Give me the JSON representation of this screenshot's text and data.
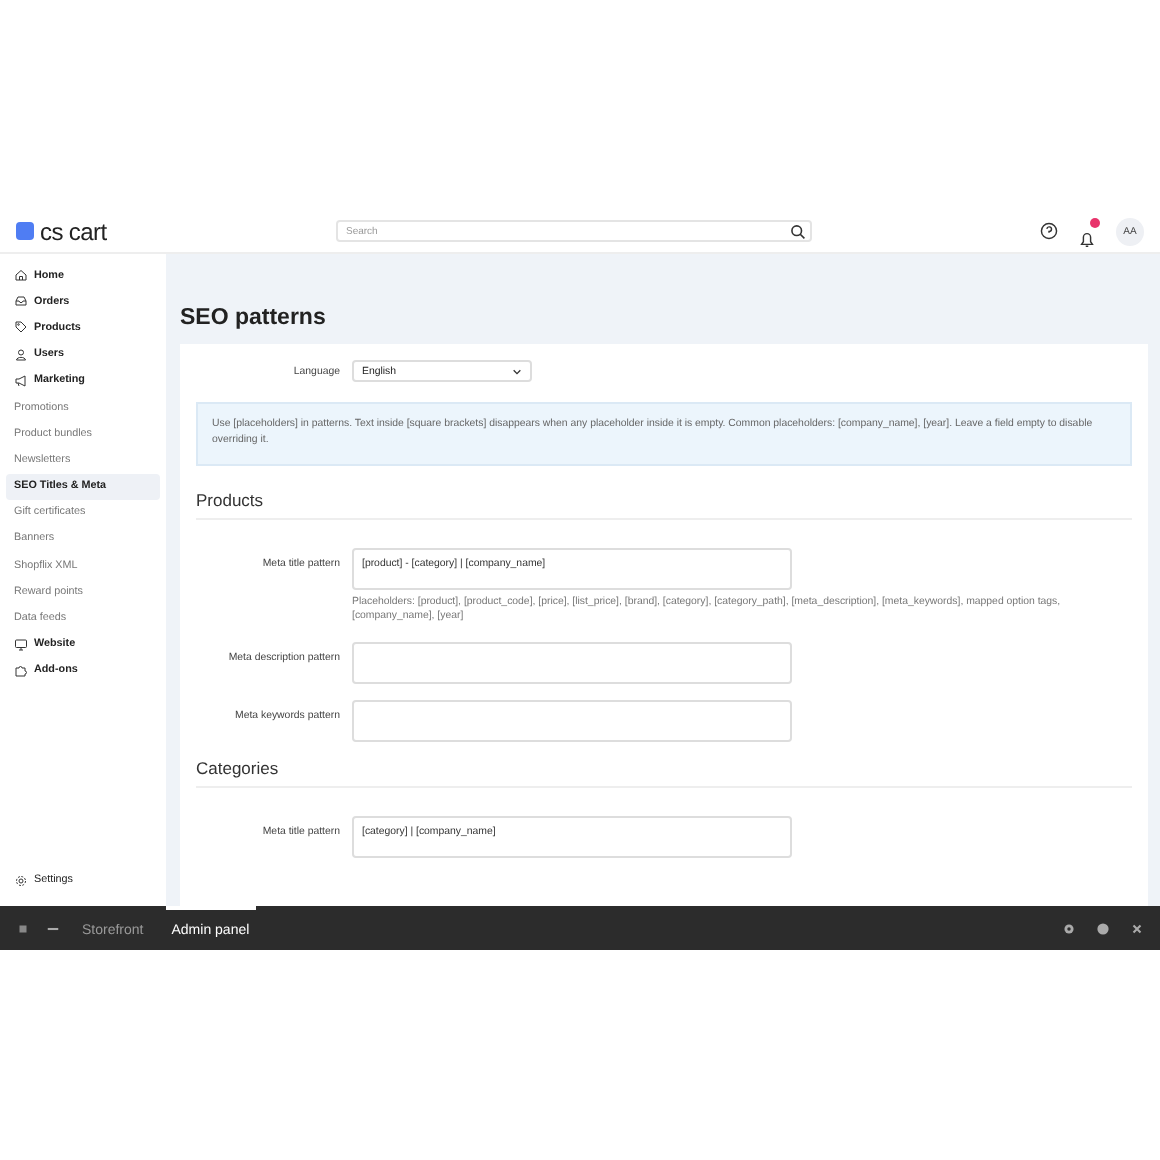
{
  "header": {
    "logo": "cs cart",
    "search": {
      "placeholder": "Search"
    },
    "avatar": "AA",
    "notification": true
  },
  "sidebar": {
    "items": [
      {
        "label": "Home",
        "kind": "main",
        "selected": false
      },
      {
        "label": "Orders",
        "kind": "main",
        "selected": false
      },
      {
        "label": "Products",
        "kind": "main",
        "selected": false
      },
      {
        "label": "Users",
        "kind": "main",
        "selected": false
      },
      {
        "label": "Marketing",
        "kind": "main",
        "selected": false
      },
      {
        "label": "Promotions",
        "kind": "sub",
        "selected": false
      },
      {
        "label": "Product bundles",
        "kind": "sub",
        "selected": false
      },
      {
        "label": "Newsletters",
        "kind": "sub",
        "selected": false
      },
      {
        "label": "SEO Titles & Meta",
        "kind": "sub",
        "selected": true
      },
      {
        "label": "Gift certificates",
        "kind": "sub",
        "selected": false
      },
      {
        "label": "Banners",
        "kind": "sub",
        "selected": false
      },
      {
        "label": "Shopflix XML",
        "kind": "sub",
        "selected": false
      },
      {
        "label": "Reward points",
        "kind": "sub",
        "selected": false
      },
      {
        "label": "Data feeds",
        "kind": "sub",
        "selected": false
      },
      {
        "label": "Website",
        "kind": "main",
        "selected": false
      },
      {
        "label": "Add-ons",
        "kind": "main",
        "selected": false
      }
    ],
    "footer": {
      "label": "Settings"
    }
  },
  "page": {
    "title": "SEO patterns",
    "language": {
      "label": "Language",
      "value": "English"
    },
    "info": "Use [placeholders] in patterns. Text inside [square brackets] disappears when any placeholder inside it is empty. Common placeholders: [company_name], [year]. Leave a field empty to disable overriding it.",
    "sections": [
      {
        "title": "Products",
        "fields": [
          {
            "label": "Meta title pattern",
            "value": "[product] - [category] | [company_name]",
            "help": "Placeholders: [product], [product_code], [price], [list_price], [brand], [category], [category_path], [meta_description], [meta_keywords], mapped option tags, [company_name], [year]"
          },
          {
            "label": "Meta description pattern"
          },
          {
            "label": "Meta keywords pattern"
          }
        ]
      },
      {
        "title": "Categories",
        "fields": [
          {
            "label": "Meta title pattern",
            "value": "[category] | [company_name]"
          }
        ]
      }
    ]
  },
  "bottom_bar": {
    "tabs": [
      {
        "label": "Storefront",
        "selected": false
      },
      {
        "label": "Admin panel",
        "selected": true
      }
    ]
  }
}
